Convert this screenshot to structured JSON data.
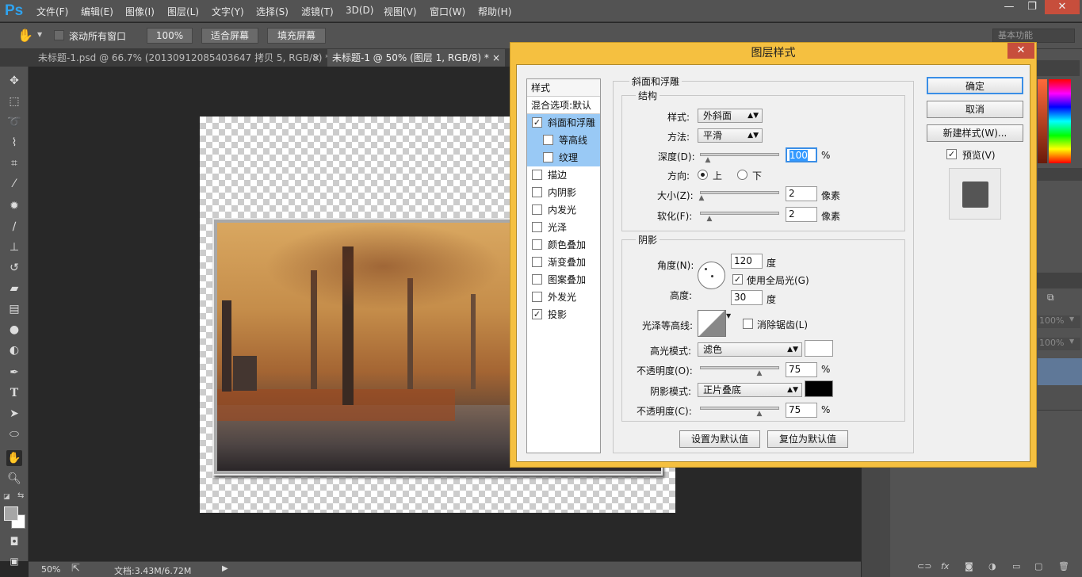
{
  "app": {
    "logo": "Ps"
  },
  "menu": [
    "文件(F)",
    "编辑(E)",
    "图像(I)",
    "图层(L)",
    "文字(Y)",
    "选择(S)",
    "滤镜(T)",
    "3D(D)",
    "视图(V)",
    "窗口(W)",
    "帮助(H)"
  ],
  "window_controls": {
    "minimize": "—",
    "restore": "❐",
    "close": "✕"
  },
  "options": {
    "scroll_all_label": "滚动所有窗口",
    "zoom_button": "100%",
    "fit_screen": "适合屏幕",
    "fill_screen": "填充屏幕",
    "workspace": "基本功能"
  },
  "tabs": [
    {
      "label": "未标题-1.psd @ 66.7% (20130912085403647 拷贝 5, RGB/8) *",
      "close": "×"
    },
    {
      "label": "未标题-1 @ 50% (图层 1, RGB/8) *",
      "close": "×"
    }
  ],
  "status": {
    "zoom": "50%",
    "doc": "文档:3.43M/6.72M"
  },
  "right_panel": {
    "opacity_1": "100%",
    "opacity_2": "100%"
  },
  "dialog": {
    "title": "图层样式",
    "close": "✕",
    "styles_header": "样式",
    "blend_header": "混合选项:默认",
    "style_items": [
      {
        "label": "斜面和浮雕",
        "checked": true,
        "selected": true
      },
      {
        "label": "等高线",
        "checked": false,
        "selected": true
      },
      {
        "label": "纹理",
        "checked": false,
        "selected": true
      },
      {
        "label": "描边",
        "checked": false
      },
      {
        "label": "内阴影",
        "checked": false
      },
      {
        "label": "内发光",
        "checked": false
      },
      {
        "label": "光泽",
        "checked": false
      },
      {
        "label": "颜色叠加",
        "checked": false
      },
      {
        "label": "渐变叠加",
        "checked": false
      },
      {
        "label": "图案叠加",
        "checked": false
      },
      {
        "label": "外发光",
        "checked": false
      },
      {
        "label": "投影",
        "checked": true
      }
    ],
    "check_mark": "✓",
    "section_title": "斜面和浮雕",
    "structure": {
      "title": "结构",
      "style_label": "样式:",
      "style_value": "外斜面",
      "method_label": "方法:",
      "method_value": "平滑",
      "depth_label": "深度(D):",
      "depth_value": "100",
      "depth_unit": "%",
      "depth_level": 0.1,
      "direction_label": "方向:",
      "direction_up": "上",
      "direction_down": "下",
      "size_label": "大小(Z):",
      "size_value": "2",
      "size_unit": "像素",
      "size_level": 0.02,
      "soften_label": "软化(F):",
      "soften_value": "2",
      "soften_unit": "像素",
      "soften_level": 0.12
    },
    "shading": {
      "title": "阴影",
      "angle_label": "角度(N):",
      "angle_value": "120",
      "angle_unit": "度",
      "global_light_label": "使用全局光(G)",
      "altitude_label": "高度:",
      "altitude_value": "30",
      "altitude_unit": "度",
      "gloss_contour_label": "光泽等高线:",
      "anti_alias_label": "消除锯齿(L)",
      "highlight_mode_label": "高光模式:",
      "highlight_mode_value": "滤色",
      "highlight_color": "#ffffff",
      "highlight_opacity_label": "不透明度(O):",
      "highlight_opacity_value": "75",
      "highlight_opacity_unit": "%",
      "highlight_opacity_level": 0.75,
      "shadow_mode_label": "阴影模式:",
      "shadow_mode_value": "正片叠底",
      "shadow_color": "#000000",
      "shadow_opacity_label": "不透明度(C):",
      "shadow_opacity_value": "75",
      "shadow_opacity_unit": "%",
      "shadow_opacity_level": 0.75
    },
    "set_default": "设置为默认值",
    "reset_default": "复位为默认值",
    "ok": "确定",
    "cancel": "取消",
    "new_style": "新建样式(W)...",
    "preview_label": "预览(V)"
  },
  "colors": {
    "accent": "#2fa3ef",
    "dialog_frame": "#f5c040",
    "selected": "#99c9f5"
  }
}
